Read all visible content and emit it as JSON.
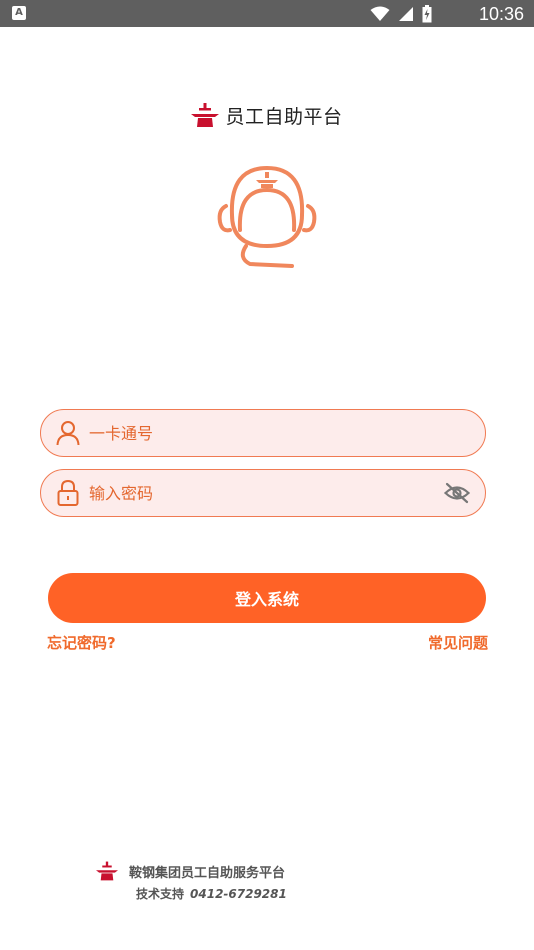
{
  "status_bar": {
    "notification_glyph": "A",
    "time": "10:36"
  },
  "header": {
    "title": "员工自助平台",
    "logo_icon": "company-logo-icon"
  },
  "mascot": {
    "icon": "helmet-mascot-icon",
    "color": "#f0875c"
  },
  "form": {
    "card_placeholder": "一卡通号",
    "card_value": "",
    "password_placeholder": "输入密码",
    "password_value": "",
    "login_label": "登入系统"
  },
  "links": {
    "forgot": "忘记密码?",
    "faq": "常见问题"
  },
  "footer": {
    "org": "鞍钢集团员工自助服务平台",
    "support_label": "技术支持",
    "phone": "0412-6729281"
  },
  "colors": {
    "accent": "#ff6226",
    "field_bg": "#fdeceb",
    "field_border": "#f07a52",
    "logo_red": "#c8102e"
  }
}
